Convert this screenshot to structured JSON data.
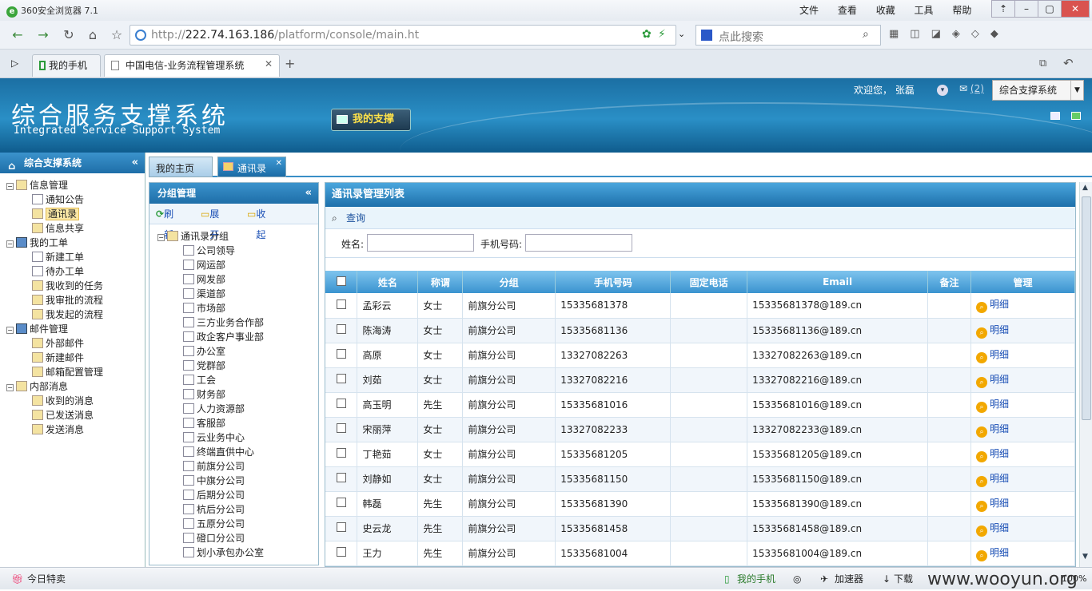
{
  "browser": {
    "title": "360安全浏览器 7.1",
    "menus": [
      "文件",
      "查看",
      "收藏",
      "工具",
      "帮助"
    ],
    "url_prefix": "http://",
    "url_host": "222.74.163.186",
    "url_path": "/platform/console/main.ht",
    "search_placeholder": "点此搜索",
    "tabs": [
      {
        "label": "我的手机"
      },
      {
        "label": "中国电信-业务流程管理系统"
      }
    ]
  },
  "header": {
    "title": "综合服务支撑系统",
    "subtitle": "Integrated Service Support System",
    "my_support": "我的支撑",
    "welcome": "欢迎您，  张磊",
    "mail_count": "(2)",
    "system_select": "综合支撑系统"
  },
  "sidebar": {
    "title": "综合支撑系统",
    "tree": [
      {
        "label": "信息管理",
        "level": 0,
        "icon": "home-icon"
      },
      {
        "label": "通知公告",
        "level": 1,
        "icon": "doc-icon"
      },
      {
        "label": "通讯录",
        "level": 1,
        "icon": "book-icon",
        "selected": true
      },
      {
        "label": "信息共享",
        "level": 1,
        "icon": "folder-icon"
      },
      {
        "label": "我的工单",
        "level": 0,
        "icon": "computer-icon"
      },
      {
        "label": "新建工单",
        "level": 1,
        "icon": "edit-icon"
      },
      {
        "label": "待办工单",
        "level": 1,
        "icon": "doc-icon"
      },
      {
        "label": "我收到的任务",
        "level": 1,
        "icon": "task-icon"
      },
      {
        "label": "我审批的流程",
        "level": 1,
        "icon": "approve-icon"
      },
      {
        "label": "我发起的流程",
        "level": 1,
        "icon": "flow-icon"
      },
      {
        "label": "邮件管理",
        "level": 0,
        "icon": "computer-icon"
      },
      {
        "label": "外部邮件",
        "level": 1,
        "icon": "mail-icon"
      },
      {
        "label": "新建邮件",
        "level": 1,
        "icon": "mail-icon"
      },
      {
        "label": "邮箱配置管理",
        "level": 1,
        "icon": "gear-icon"
      },
      {
        "label": "内部消息",
        "level": 0,
        "icon": "envelope-icon"
      },
      {
        "label": "收到的消息",
        "level": 1,
        "icon": "inbox-icon"
      },
      {
        "label": "已发送消息",
        "level": 1,
        "icon": "folder-icon"
      },
      {
        "label": "发送消息",
        "level": 1,
        "icon": "send-icon"
      }
    ]
  },
  "content_tabs": [
    {
      "label": "我的主页"
    },
    {
      "label": "通讯录"
    }
  ],
  "groups": {
    "title": "分组管理",
    "tools": {
      "refresh": "刷新",
      "expand": "展开",
      "collapse": "收起"
    },
    "root": "通讯录分组",
    "items": [
      "公司领导",
      "网运部",
      "网发部",
      "渠道部",
      "市场部",
      "三方业务合作部",
      "政企客户事业部",
      "办公室",
      "党群部",
      "工会",
      "财务部",
      "人力资源部",
      "客服部",
      "云业务中心",
      "终端直供中心",
      "前旗分公司",
      "中旗分公司",
      "后期分公司",
      "杭后分公司",
      "五原分公司",
      "磴口分公司",
      "划小承包办公室"
    ]
  },
  "list": {
    "title": "通讯录管理列表",
    "query": "查询",
    "name_label": "姓名:",
    "phone_label": "手机号码:",
    "columns": [
      "姓名",
      "称谓",
      "分组",
      "手机号码",
      "固定电话",
      "Email",
      "备注",
      "管理"
    ],
    "detail_label": "明细",
    "rows": [
      [
        "孟彩云",
        "女士",
        "前旗分公司",
        "15335681378",
        "",
        "15335681378@189.cn",
        ""
      ],
      [
        "陈海涛",
        "女士",
        "前旗分公司",
        "15335681136",
        "",
        "15335681136@189.cn",
        ""
      ],
      [
        "高原",
        "女士",
        "前旗分公司",
        "13327082263",
        "",
        "13327082263@189.cn",
        ""
      ],
      [
        "刘茹",
        "女士",
        "前旗分公司",
        "13327082216",
        "",
        "13327082216@189.cn",
        ""
      ],
      [
        "高玉明",
        "先生",
        "前旗分公司",
        "15335681016",
        "",
        "15335681016@189.cn",
        ""
      ],
      [
        "宋丽萍",
        "女士",
        "前旗分公司",
        "13327082233",
        "",
        "13327082233@189.cn",
        ""
      ],
      [
        "丁艳茹",
        "女士",
        "前旗分公司",
        "15335681205",
        "",
        "15335681205@189.cn",
        ""
      ],
      [
        "刘静如",
        "女士",
        "前旗分公司",
        "15335681150",
        "",
        "15335681150@189.cn",
        ""
      ],
      [
        "韩磊",
        "先生",
        "前旗分公司",
        "15335681390",
        "",
        "15335681390@189.cn",
        ""
      ],
      [
        "史云龙",
        "先生",
        "前旗分公司",
        "15335681458",
        "",
        "15335681458@189.cn",
        ""
      ],
      [
        "王力",
        "先生",
        "前旗分公司",
        "15335681004",
        "",
        "15335681004@189.cn",
        ""
      ]
    ]
  },
  "statusbar": {
    "left": "今日特卖",
    "phone": "我的手机",
    "accelerator": "加速器",
    "download": "下载",
    "zoom": "100%",
    "watermark": "www.wooyun.org"
  }
}
